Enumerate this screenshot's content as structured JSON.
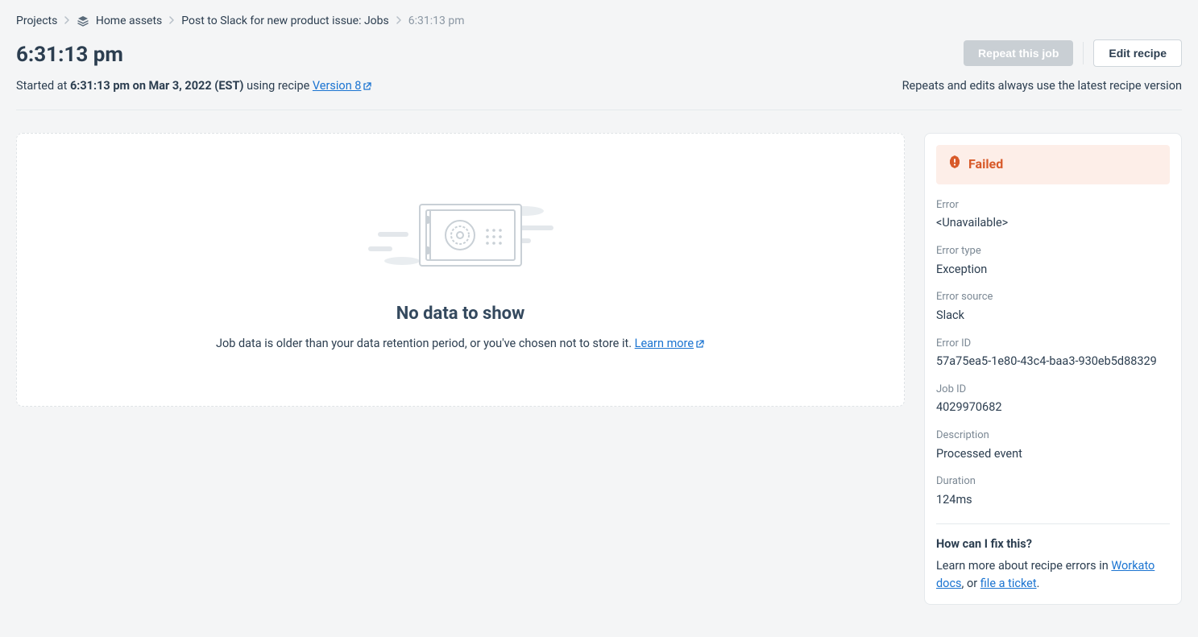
{
  "breadcrumb": {
    "projects": "Projects",
    "home_assets": "Home assets",
    "recipe_jobs": "Post to Slack for new product issue: Jobs",
    "current": "6:31:13 pm"
  },
  "page_title": "6:31:13 pm",
  "actions": {
    "repeat_label": "Repeat this job",
    "edit_label": "Edit recipe"
  },
  "subhead": {
    "prefix": "Started at ",
    "timestamp": "6:31:13 pm on Mar 3, 2022 (EST)",
    "using": " using recipe ",
    "version_label": "Version 8",
    "right_note": "Repeats and edits always use the latest recipe version"
  },
  "empty": {
    "title": "No data to show",
    "text": "Job data is older than your data retention period, or you've chosen not to store it. ",
    "learn_more": "Learn more"
  },
  "status": {
    "label": "Failed"
  },
  "details": {
    "error_label": "Error",
    "error_value": "<Unavailable>",
    "error_type_label": "Error type",
    "error_type_value": "Exception",
    "error_source_label": "Error source",
    "error_source_value": "Slack",
    "error_id_label": "Error ID",
    "error_id_value": "57a75ea5-1e80-43c4-baa3-930eb5d88329",
    "job_id_label": "Job ID",
    "job_id_value": "4029970682",
    "description_label": "Description",
    "description_value": "Processed event",
    "duration_label": "Duration",
    "duration_value": "124ms"
  },
  "fix": {
    "title": "How can I fix this?",
    "prefix": "Learn more about recipe errors in ",
    "docs_link": "Workato docs",
    "sep": ", or ",
    "ticket_link": "file a ticket",
    "suffix": "."
  }
}
